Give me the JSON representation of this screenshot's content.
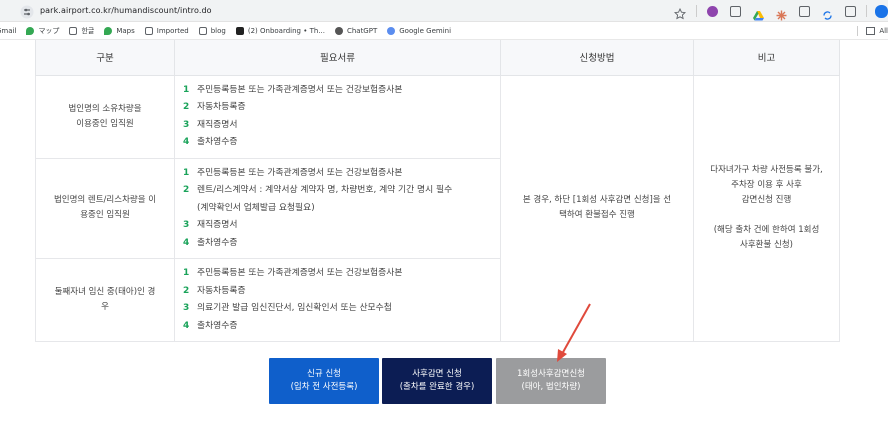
{
  "browser": {
    "url": "park.airport.co.kr/humandiscount/intro.do",
    "bookmarks": [
      "Gmail",
      "マップ",
      "한글",
      "Maps",
      "Imported",
      "blog",
      "(2) Onboarding • Th...",
      "ChatGPT",
      "Google Gemini"
    ],
    "all_bookmarks": "All"
  },
  "table": {
    "headers": [
      "구분",
      "필요서류",
      "신청방법",
      "비고"
    ],
    "rows": [
      {
        "category_line1": "법인명의 소유차량을",
        "category_line2": "이용중인 임직원",
        "items": [
          {
            "num": "1",
            "text": "주민등록등본 또는 가족관계증명서 또는 건강보험증사본"
          },
          {
            "num": "2",
            "text": "자동차등록증"
          },
          {
            "num": "3",
            "text": "재직증명서"
          },
          {
            "num": "4",
            "text": "출차영수증"
          }
        ]
      },
      {
        "category_line1": "법인명의 렌트/리스차량을 이",
        "category_line2": "용중인 임직원",
        "items": [
          {
            "num": "1",
            "text": "주민등록등본 또는 가족관계증명서 또는 건강보험증사본"
          },
          {
            "num": "2",
            "text": "렌트/리스계약서 : 계약서상 계약자 명, 차량번호, 계약 기간 명시 필수"
          },
          {
            "num": "",
            "text": "(계약확인서 업체발급 요청필요)"
          },
          {
            "num": "3",
            "text": "재직증명서"
          },
          {
            "num": "4",
            "text": "출차영수증"
          }
        ]
      },
      {
        "category_line1": "둘째자녀 임신 중(태아)인 경",
        "category_line2": "우",
        "items": [
          {
            "num": "1",
            "text": "주민등록등본 또는 가족관계증명서 또는 건강보험증사본"
          },
          {
            "num": "2",
            "text": "자동차등록증"
          },
          {
            "num": "3",
            "text": "의료기관 발급 임신진단서, 임신확인서 또는 산모수첩"
          },
          {
            "num": "4",
            "text": "출차영수증"
          }
        ]
      }
    ],
    "method_line1": "본 경우, 하단 [1회성 사후감면 신청]을 선",
    "method_line2": "택하여 환불접수 진행",
    "note_line1": "다자녀가구 차량 사전등록 불가,",
    "note_line2": "주차장 이용 후 사후",
    "note_line3": "감면신청 진행",
    "note_line4": "(해당 출차 건에 한하여 1회성",
    "note_line5": "사후환불 신청)"
  },
  "buttons": [
    {
      "line1": "신규 신청",
      "line2": "(입차 전 사전등록)"
    },
    {
      "line1": "사후감면 신청",
      "line2": "(출차를 완료한 경우)"
    },
    {
      "line1": "1회성사후감면신청",
      "line2": "(태아, 법인차량)"
    }
  ],
  "colors": {
    "btn_blue": "#0f5fcb",
    "btn_navy": "#0c1d54",
    "btn_gray": "#9b9c9e",
    "number_green": "#1aa35a",
    "arrow_red": "#e04a3c"
  }
}
